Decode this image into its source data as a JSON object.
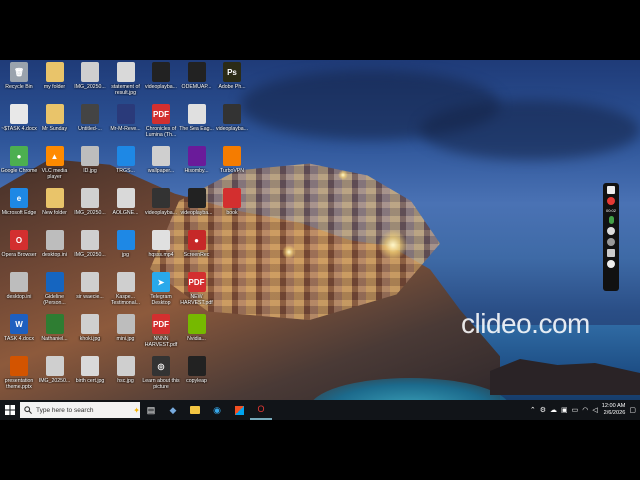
{
  "desktop": {
    "icons": [
      {
        "label": "Recycle Bin",
        "color": "#9aa3ad",
        "glyph": "🗑"
      },
      {
        "label": "my folder",
        "color": "#e9c46a",
        "glyph": ""
      },
      {
        "label": "IMG_20250...",
        "color": "#cfcfcf",
        "glyph": ""
      },
      {
        "label": "statement of result.jpg",
        "color": "#d9d9d9",
        "glyph": ""
      },
      {
        "label": "videoplayba...",
        "color": "#222222",
        "glyph": ""
      },
      {
        "label": "ODEMUAP...",
        "color": "#222222",
        "glyph": ""
      },
      {
        "label": "Adobe Ph...",
        "color": "#2b2b16",
        "glyph": "Ps"
      },
      {
        "label": "~$TASK 4.docx",
        "color": "#e8e8e8",
        "glyph": ""
      },
      {
        "label": "Mr Sunday",
        "color": "#e9c46a",
        "glyph": ""
      },
      {
        "label": "Untitled-...",
        "color": "#444444",
        "glyph": ""
      },
      {
        "label": "Mr-M-Reve...",
        "color": "#2a3a7a",
        "glyph": ""
      },
      {
        "label": "Chronicles of Lumina (Th...",
        "color": "#d32f2f",
        "glyph": "PDF"
      },
      {
        "label": "The Sea Eag...",
        "color": "#e0e0e0",
        "glyph": ""
      },
      {
        "label": "videoplayba...",
        "color": "#333333",
        "glyph": ""
      },
      {
        "label": "Google Chrome",
        "color": "#4caf50",
        "glyph": "●"
      },
      {
        "label": "VLC media player",
        "color": "#ff8a00",
        "glyph": "▲"
      },
      {
        "label": "ID.jpg",
        "color": "#bdbdbd",
        "glyph": ""
      },
      {
        "label": "TRGS...",
        "color": "#1e88e5",
        "glyph": ""
      },
      {
        "label": "wallpaper...",
        "color": "#cfcfcf",
        "glyph": ""
      },
      {
        "label": "Hisomby...",
        "color": "#6a1b9a",
        "glyph": ""
      },
      {
        "label": "TurboVPN",
        "color": "#f57c00",
        "glyph": ""
      },
      {
        "label": "Microsoft Edge",
        "color": "#1e88e5",
        "glyph": "e"
      },
      {
        "label": "New folder",
        "color": "#e9c46a",
        "glyph": ""
      },
      {
        "label": "IMG_20250...",
        "color": "#d0d0d0",
        "glyph": ""
      },
      {
        "label": "AOLGNE...",
        "color": "#d9d9d9",
        "glyph": ""
      },
      {
        "label": "videoplayba...",
        "color": "#333333",
        "glyph": ""
      },
      {
        "label": "videoplayba...",
        "color": "#222222",
        "glyph": ""
      },
      {
        "label": "book",
        "color": "#d32f2f",
        "glyph": ""
      },
      {
        "label": "Opera Browser",
        "color": "#d32f2f",
        "glyph": "O"
      },
      {
        "label": "desktop.ini",
        "color": "#bdbdbd",
        "glyph": ""
      },
      {
        "label": "IMG_20250...",
        "color": "#cfcfcf",
        "glyph": ""
      },
      {
        "label": "jpg",
        "color": "#1e88e5",
        "glyph": ""
      },
      {
        "label": "hqsss.mp4",
        "color": "#e0e0e0",
        "glyph": ""
      },
      {
        "label": "ScreenRec",
        "color": "#c62828",
        "glyph": "●"
      },
      {
        "label": "",
        "color": "transparent",
        "glyph": ""
      },
      {
        "label": "desktop.ini",
        "color": "#bdbdbd",
        "glyph": ""
      },
      {
        "label": "Gideline (Person...",
        "color": "#1565c0",
        "glyph": ""
      },
      {
        "label": "sir waecie...",
        "color": "#cfcfcf",
        "glyph": ""
      },
      {
        "label": "Kaspe... Testimonal...",
        "color": "#cfcfcf",
        "glyph": ""
      },
      {
        "label": "Telegram Desktop",
        "color": "#29a9eb",
        "glyph": "➤"
      },
      {
        "label": "NEW HARVEST.pdf",
        "color": "#d32f2f",
        "glyph": "PDF"
      },
      {
        "label": "",
        "color": "transparent",
        "glyph": ""
      },
      {
        "label": "TASK 4.docx",
        "color": "#1e5fbf",
        "glyph": "W"
      },
      {
        "label": "Nathaniel...",
        "color": "#2e7d32",
        "glyph": ""
      },
      {
        "label": "khoki.jpg",
        "color": "#cfcfcf",
        "glyph": ""
      },
      {
        "label": "mini.jpg",
        "color": "#bdbdbd",
        "glyph": ""
      },
      {
        "label": "NNNN HARVEST.pdf",
        "color": "#d32f2f",
        "glyph": "PDF"
      },
      {
        "label": "Nvidia...",
        "color": "#76b900",
        "glyph": ""
      },
      {
        "label": "",
        "color": "transparent",
        "glyph": ""
      },
      {
        "label": "presentation theme.pptx",
        "color": "#d35400",
        "glyph": ""
      },
      {
        "label": "IMG_20250...",
        "color": "#cfcfcf",
        "glyph": ""
      },
      {
        "label": "birth cert.jpg",
        "color": "#d9d9d9",
        "glyph": ""
      },
      {
        "label": "hsc.jpg",
        "color": "#cfcfcf",
        "glyph": ""
      },
      {
        "label": "Learn about this picture",
        "color": "#333333",
        "glyph": "◎"
      },
      {
        "label": "copyleap",
        "color": "#222222",
        "glyph": ""
      },
      {
        "label": "",
        "color": "transparent",
        "glyph": ""
      }
    ]
  },
  "toolbar": {
    "time_readout": "00:02"
  },
  "watermark": "clideo.com",
  "taskbar": {
    "search_placeholder": "Type here to search",
    "clock_time": "12:00 AM",
    "clock_date": "2/6/2026"
  },
  "colors": {
    "taskbar_bg": "#111418",
    "accent": "#0078d4"
  }
}
